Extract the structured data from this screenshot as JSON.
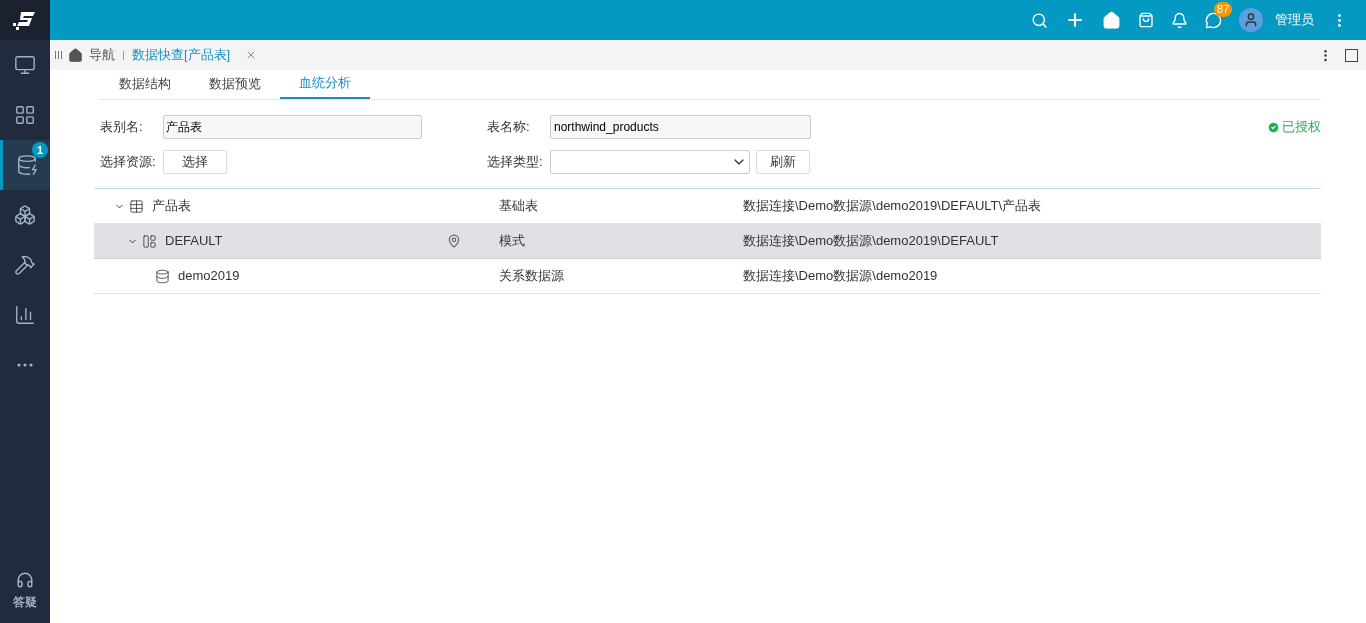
{
  "sidebar": {
    "items": [
      {
        "kind": "monitor",
        "selected": false
      },
      {
        "kind": "widgets",
        "selected": false
      },
      {
        "kind": "database",
        "selected": true,
        "badge": "1"
      },
      {
        "kind": "cubes",
        "selected": false
      },
      {
        "kind": "tools",
        "selected": false
      },
      {
        "kind": "chart",
        "selected": false
      },
      {
        "kind": "more",
        "selected": false
      }
    ],
    "help": {
      "label": "答疑"
    }
  },
  "topbar": {
    "message_badge": "87",
    "user": "管理员"
  },
  "tabbar": {
    "tabs": [
      {
        "label": "导航",
        "kind": "home",
        "selected": false
      },
      {
        "label": "数据快查[产品表]",
        "kind": "page",
        "selected": true
      }
    ]
  },
  "subtabs": [
    {
      "label": "数据结构",
      "selected": false
    },
    {
      "label": "数据预览",
      "selected": false
    },
    {
      "label": "血统分析",
      "selected": true
    }
  ],
  "form": {
    "alias_label": "表别名:",
    "alias_value": "产品表",
    "name_label": "表名称:",
    "name_value": "northwind_products",
    "status": "已授权",
    "source_label": "选择资源:",
    "source_button": "选择",
    "type_label": "选择类型:",
    "refresh_button": "刷新"
  },
  "tree": [
    {
      "name": "产品表",
      "kind": "table",
      "type": "基础表",
      "path": "数据连接\\Demo数据源\\demo2019\\DEFAULT\\产品表",
      "expanded": true,
      "selected": false,
      "children": [
        {
          "name": "DEFAULT",
          "kind": "schema",
          "type": "模式",
          "path": "数据连接\\Demo数据源\\demo2019\\DEFAULT",
          "expanded": true,
          "selected": true,
          "children": [
            {
              "name": "demo2019",
              "kind": "database",
              "type": "关系数据源",
              "path": "数据连接\\Demo数据源\\demo2019",
              "selected": false
            }
          ]
        }
      ]
    }
  ]
}
